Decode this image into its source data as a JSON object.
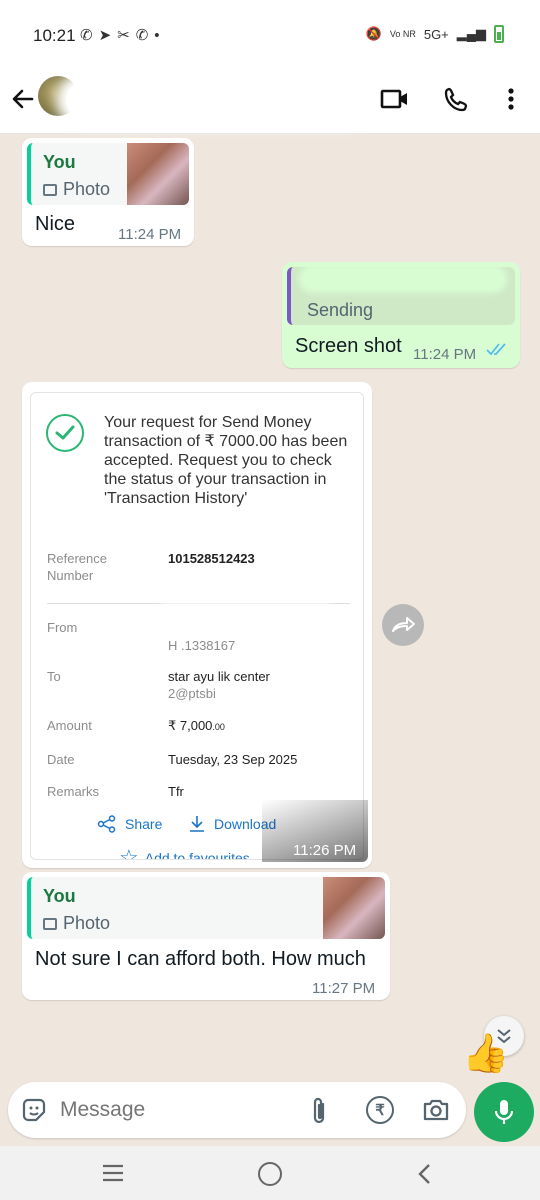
{
  "status_bar": {
    "time": "10:21",
    "network": "5G+",
    "volte": "Vo NR"
  },
  "header": {
    "icons": [
      "back-arrow-icon",
      "video-call-icon",
      "voice-call-icon",
      "more-options-icon"
    ]
  },
  "messages": [
    {
      "quote_author": "You",
      "quote_type": "Photo",
      "text": "Nice",
      "time": "11:24 PM"
    },
    {
      "quote_status": "Sending",
      "text": "Screen shot",
      "time": "11:24 PM"
    },
    {
      "time": "11:26 PM",
      "receipt": {
        "message": "Your request for Send Money transaction of ₹ 7000.00 has been accepted. Request you to check the status of your transaction in 'Transaction History'",
        "reference_label": "Reference Number",
        "reference_value": "101528512423",
        "from_label": "From",
        "from_value": "H                 .1338167",
        "to_label": "To",
        "to_value_1": "star ayu      lik center",
        "to_value_2": "       2@ptsbi",
        "amount_label": "Amount",
        "amount_value": "₹ 7,000",
        "amount_decimals": ".00",
        "date_label": "Date",
        "date_value": "Tuesday, 23 Sep 2025",
        "remarks_label": "Remarks",
        "remarks_value": "Tfr",
        "share_label": "Share",
        "download_label": "Download",
        "favourites_label": "Add to favourites"
      }
    },
    {
      "quote_author": "You",
      "quote_type": "Photo",
      "text": "Not sure I can afford both. How much",
      "time": "11:27 PM"
    }
  ],
  "composer": {
    "placeholder": "Message"
  },
  "colors": {
    "accent": "#1daa61",
    "outgoing_bubble": "#d9fdd3",
    "link_blue": "#1a73c8"
  }
}
